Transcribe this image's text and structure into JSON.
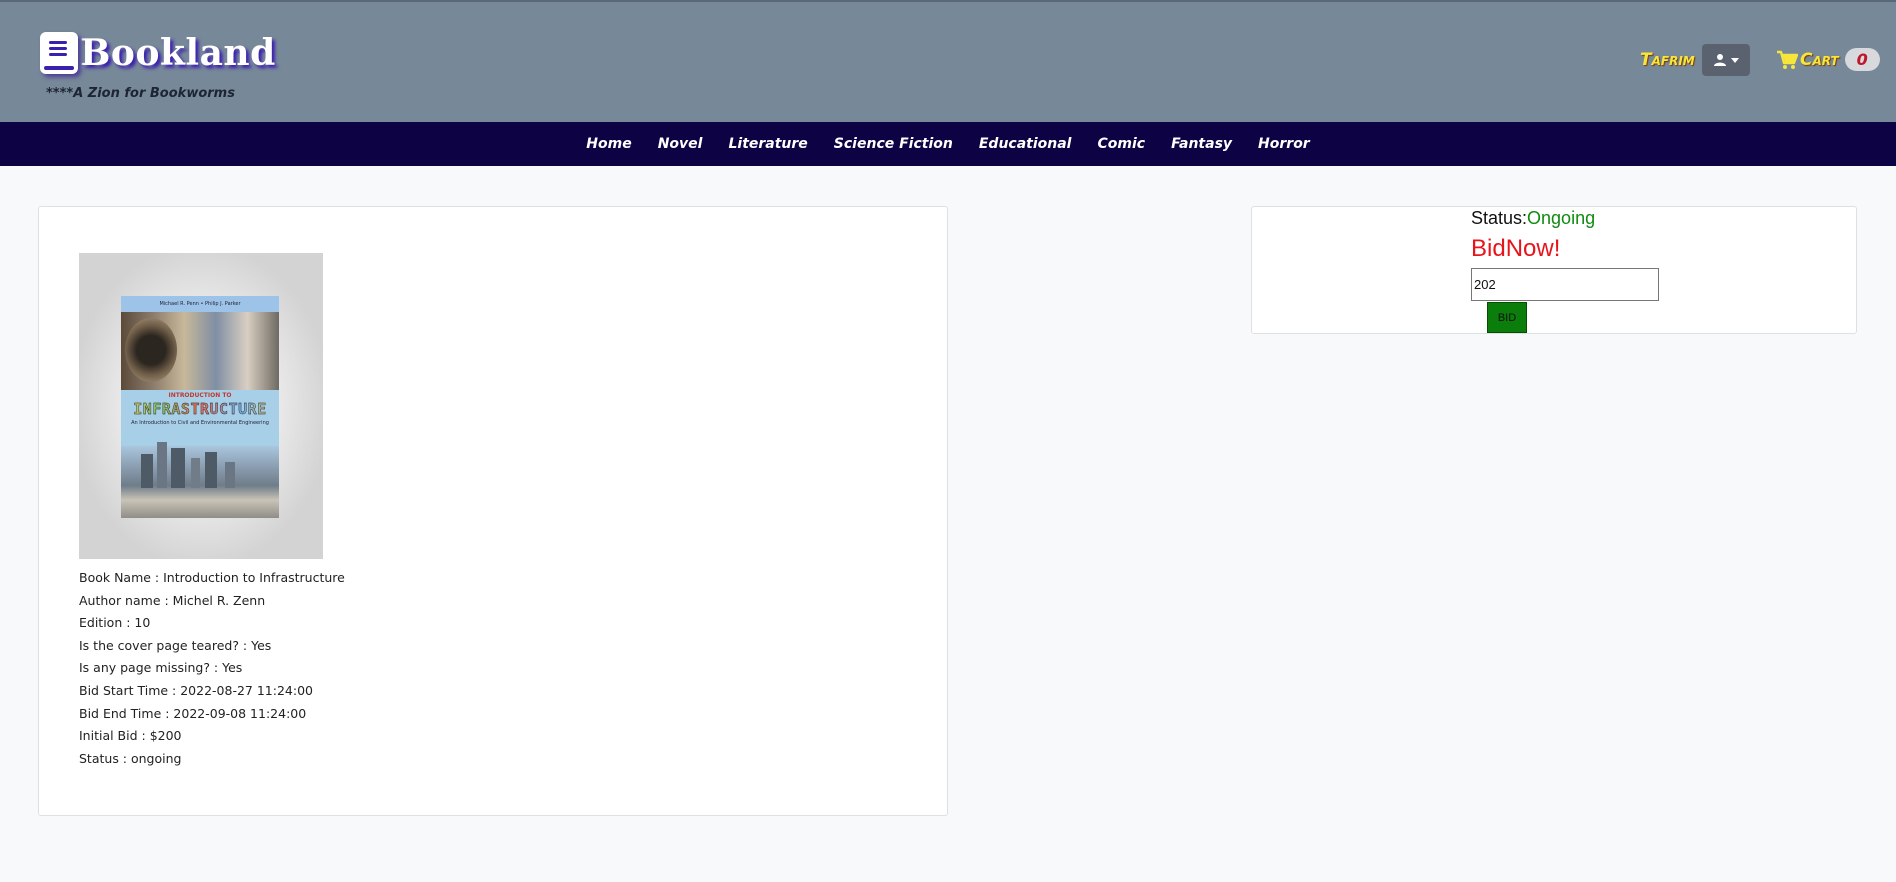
{
  "header": {
    "logo_text": "Bookland",
    "tagline": "****A Zion for Bookworms",
    "user_name": "Tafrim",
    "cart_label": "Cart",
    "cart_count": "0",
    "accent_color": "#f6e53a",
    "bar_color": "#778899"
  },
  "nav": {
    "items": [
      {
        "label": "Home"
      },
      {
        "label": "Novel"
      },
      {
        "label": "Literature"
      },
      {
        "label": "Science Fiction"
      },
      {
        "label": "Educational"
      },
      {
        "label": "Comic"
      },
      {
        "label": "Fantasy"
      },
      {
        "label": "Horror"
      }
    ],
    "bg_color": "#0c0244"
  },
  "book": {
    "cover": {
      "authors": "Michael R. Penn • Philip J. Parker",
      "intro": "INTRODUCTION TO",
      "title": "INFRASTRUCTURE",
      "subtitle": "An Introduction to Civil and Environmental Engineering"
    },
    "details": [
      "Book Name : Introduction to Infrastructure",
      "Author name : Michel R. Zenn",
      "Edition : 10",
      "Is the cover page teared? : Yes",
      "Is any page missing? : Yes",
      "Bid Start Time : 2022-08-27 11:24:00",
      "Bid End Time : 2022-09-08 11:24:00",
      "Initial Bid : $200",
      "Status : ongoing"
    ]
  },
  "bid_panel": {
    "status_label": "Status:",
    "status_value": "Ongoing",
    "heading": "BidNow!",
    "input_value": "202",
    "button_label": "BID",
    "status_color": "#108a10",
    "heading_color": "#e8141b"
  }
}
